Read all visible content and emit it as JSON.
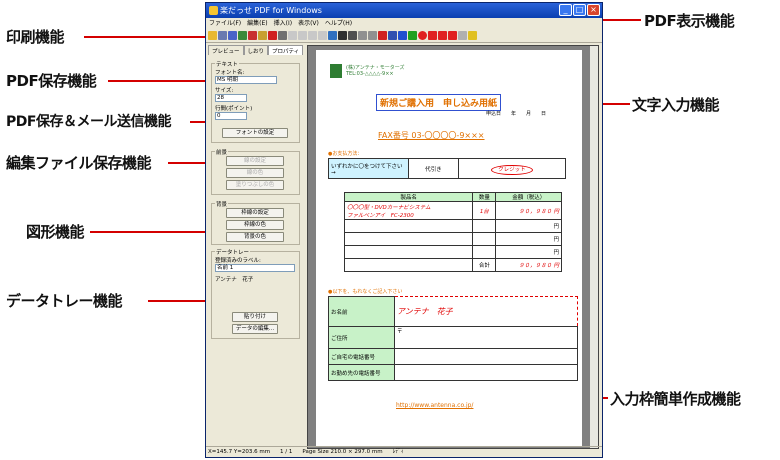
{
  "callouts": {
    "print": "印刷機能",
    "pdf_save": "PDF保存機能",
    "pdf_save_mail": "PDF保存＆メール送信機能",
    "edit_save": "編集ファイル保存機能",
    "shape": "図形機能",
    "data_tray": "データトレー機能",
    "pdf_view": "PDF表示機能",
    "text_input": "文字入力機能",
    "input_frame": "入力枠簡単作成機能"
  },
  "window": {
    "title": "楽だっせ PDF for Windows",
    "menu": [
      "ファイル(F)",
      "編集(E)",
      "挿入(I)",
      "表示(V)",
      "ヘルプ(H)"
    ]
  },
  "panel": {
    "tabs": [
      "プレビュー",
      "しおり",
      "プロパティ"
    ],
    "text_group": "テキスト",
    "font_name_label": "フォント名:",
    "font_name_value": "MS 明朝",
    "size_label": "サイズ:",
    "size_value": "28",
    "spacing_label": "行間(ポイント)",
    "spacing_value": "0",
    "font_settings_button": "フォントの設定",
    "front_group": "前景",
    "line_settings_button": "線の設定",
    "line_color_button": "線の色",
    "fill_color_button": "塗りつぶしの色",
    "back_group": "背景",
    "frame_settings_button": "枠線の設定",
    "frame_color_button": "枠線の色",
    "bg_color_button": "背景の色",
    "tray_group": "データトレー",
    "tray_label": "登録済みのラベル:",
    "tray_value": "名前 1",
    "tray_item": "アンテナ　花子",
    "paste_button": "貼り付け",
    "data_edit_button": "データの編集..."
  },
  "document": {
    "company_name": "(株)アンテナ・モーターズ",
    "company_tel": "TEL:03-△△△△-9××",
    "title_box": "新規ご購入用　申し込み用紙",
    "date_label": "申込日　　年　　月　　日",
    "fax": "FAX番号 03-〇〇〇〇-9×××",
    "payment_header": "●お支払方法：",
    "payment_prompt": "いずれかに〇をつけて下さい→",
    "payment_opt1": "代引き",
    "payment_opt2": "クレジット",
    "order_headers": [
      "製品名",
      "数量",
      "金額（税込）"
    ],
    "order_item_line1": "〇〇〇型・DVDカーナビシステム",
    "order_item_line2": "ファルベンアイ　FC-2300",
    "order_qty": "1台",
    "order_price": "９０，９８０ 円",
    "yen": "円",
    "total_label": "合計",
    "total_price": "９０，９８０ 円",
    "customer_header": "●以下を、もれなくご記入下さい",
    "rows": [
      "お名前",
      "ご住所",
      "ご自宅の電話番号",
      "お勤め先の電話番号"
    ],
    "name_value": "アンテナ　花子",
    "zip_mark": "〒",
    "url": "http://www.antenna.co.jp/"
  },
  "status": {
    "coords": "X=145.7 Y=203.6 mm",
    "page": "1 / 1",
    "page_size": "Page Size 210.0 × 297.0 mm",
    "mode": "ﾚﾃﾞｨ"
  },
  "colors": {
    "accent": "#e00000",
    "title_bar": "#0a3fb0"
  }
}
